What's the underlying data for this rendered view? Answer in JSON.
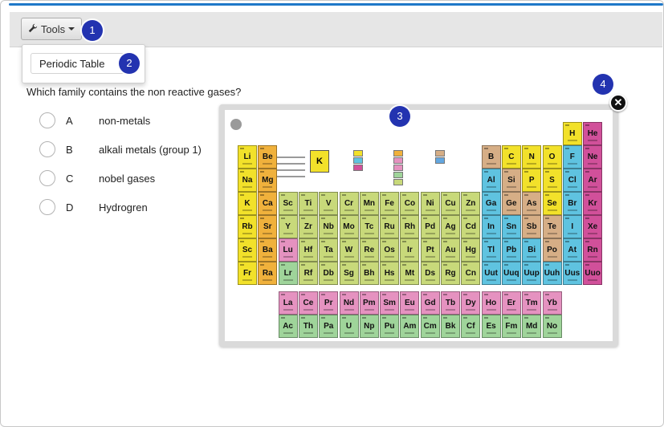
{
  "toolbar": {
    "tools_label": "Tools"
  },
  "dropdown": {
    "item": "Periodic Table"
  },
  "badges": [
    "1",
    "2",
    "3",
    "4"
  ],
  "question": {
    "text": "Which family contains the non reactive gases?"
  },
  "options": [
    {
      "letter": "A",
      "text": "non-metals"
    },
    {
      "letter": "B",
      "text": "alkali metals (group 1)"
    },
    {
      "letter": "C",
      "text": "nobel gases"
    },
    {
      "letter": "D",
      "text": "Hydrogren"
    }
  ],
  "popup": {
    "close_icon": "close-icon"
  },
  "colors": {
    "accent": "#1f78c8",
    "badge": "#2333b0",
    "yellow": "#f2e12a",
    "orange": "#f0b13c",
    "lime": "#c8d97a",
    "pink": "#e592c0",
    "cyan": "#5fc3e0",
    "tan": "#d6ae86",
    "magenta": "#d1509a",
    "green": "#9fd49a",
    "blue": "#63a7e0"
  },
  "periodic_table": {
    "rows": [
      {
        "cells": [
          [
            "H",
            "yellow"
          ],
          [
            "He",
            "magenta"
          ]
        ]
      },
      {
        "cells": [
          [
            "Li",
            "yellow"
          ],
          [
            "Be",
            "orange"
          ],
          [
            "B",
            "tan"
          ],
          [
            "C",
            "yellow"
          ],
          [
            "N",
            "yellow"
          ],
          [
            "O",
            "yellow"
          ],
          [
            "F",
            "cyan"
          ],
          [
            "Ne",
            "magenta"
          ]
        ]
      },
      {
        "cells": [
          [
            "Na",
            "yellow"
          ],
          [
            "Mg",
            "orange"
          ],
          [
            "Al",
            "cyan"
          ],
          [
            "Si",
            "tan"
          ],
          [
            "P",
            "yellow"
          ],
          [
            "S",
            "yellow"
          ],
          [
            "Cl",
            "cyan"
          ],
          [
            "Ar",
            "magenta"
          ]
        ]
      },
      {
        "cells": [
          [
            "K",
            "yellow"
          ],
          [
            "Ca",
            "orange"
          ],
          [
            "Sc",
            "lime"
          ],
          [
            "Ti",
            "lime"
          ],
          [
            "V",
            "lime"
          ],
          [
            "Cr",
            "lime"
          ],
          [
            "Mn",
            "lime"
          ],
          [
            "Fe",
            "lime"
          ],
          [
            "Co",
            "lime"
          ],
          [
            "Ni",
            "lime"
          ],
          [
            "Cu",
            "lime"
          ],
          [
            "Zn",
            "lime"
          ],
          [
            "Ga",
            "cyan"
          ],
          [
            "Ge",
            "tan"
          ],
          [
            "As",
            "tan"
          ],
          [
            "Se",
            "yellow"
          ],
          [
            "Br",
            "cyan"
          ],
          [
            "Kr",
            "magenta"
          ]
        ]
      },
      {
        "cells": [
          [
            "Rb",
            "yellow"
          ],
          [
            "Sr",
            "orange"
          ],
          [
            "Y",
            "lime"
          ],
          [
            "Zr",
            "lime"
          ],
          [
            "Nb",
            "lime"
          ],
          [
            "Mo",
            "lime"
          ],
          [
            "Tc",
            "lime"
          ],
          [
            "Ru",
            "lime"
          ],
          [
            "Rh",
            "lime"
          ],
          [
            "Pd",
            "lime"
          ],
          [
            "Ag",
            "lime"
          ],
          [
            "Cd",
            "lime"
          ],
          [
            "In",
            "cyan"
          ],
          [
            "Sn",
            "cyan"
          ],
          [
            "Sb",
            "tan"
          ],
          [
            "Te",
            "tan"
          ],
          [
            "I",
            "cyan"
          ],
          [
            "Xe",
            "magenta"
          ]
        ]
      },
      {
        "cells": [
          [
            "Sc",
            "yellow"
          ],
          [
            "Ba",
            "orange"
          ],
          [
            "Lu",
            "pink"
          ],
          [
            "Hf",
            "lime"
          ],
          [
            "Ta",
            "lime"
          ],
          [
            "W",
            "lime"
          ],
          [
            "Re",
            "lime"
          ],
          [
            "Os",
            "lime"
          ],
          [
            "Ir",
            "lime"
          ],
          [
            "Pt",
            "lime"
          ],
          [
            "Au",
            "lime"
          ],
          [
            "Hg",
            "lime"
          ],
          [
            "Tl",
            "cyan"
          ],
          [
            "Pb",
            "cyan"
          ],
          [
            "Bi",
            "cyan"
          ],
          [
            "Po",
            "tan"
          ],
          [
            "At",
            "cyan"
          ],
          [
            "Rn",
            "magenta"
          ]
        ]
      },
      {
        "cells": [
          [
            "Fr",
            "yellow"
          ],
          [
            "Ra",
            "orange"
          ],
          [
            "Lr",
            "green"
          ],
          [
            "Rf",
            "lime"
          ],
          [
            "Db",
            "lime"
          ],
          [
            "Sg",
            "lime"
          ],
          [
            "Bh",
            "lime"
          ],
          [
            "Hs",
            "lime"
          ],
          [
            "Mt",
            "lime"
          ],
          [
            "Ds",
            "lime"
          ],
          [
            "Rg",
            "lime"
          ],
          [
            "Cn",
            "lime"
          ],
          [
            "Uut",
            "cyan"
          ],
          [
            "Uuq",
            "cyan"
          ],
          [
            "Uup",
            "cyan"
          ],
          [
            "Uuh",
            "cyan"
          ],
          [
            "Uus",
            "cyan"
          ],
          [
            "Uuo",
            "magenta"
          ]
        ]
      },
      {
        "cells": [
          [
            "La",
            "pink"
          ],
          [
            "Ce",
            "pink"
          ],
          [
            "Pr",
            "pink"
          ],
          [
            "Nd",
            "pink"
          ],
          [
            "Pm",
            "pink"
          ],
          [
            "Sm",
            "pink"
          ],
          [
            "Eu",
            "pink"
          ],
          [
            "Gd",
            "pink"
          ],
          [
            "Tb",
            "pink"
          ],
          [
            "Dy",
            "pink"
          ],
          [
            "Ho",
            "pink"
          ],
          [
            "Er",
            "pink"
          ],
          [
            "Tm",
            "pink"
          ],
          [
            "Yb",
            "pink"
          ]
        ]
      },
      {
        "cells": [
          [
            "Ac",
            "green"
          ],
          [
            "Th",
            "green"
          ],
          [
            "Pa",
            "green"
          ],
          [
            "U",
            "green"
          ],
          [
            "Np",
            "green"
          ],
          [
            "Pu",
            "green"
          ],
          [
            "Am",
            "green"
          ],
          [
            "Cm",
            "green"
          ],
          [
            "Bk",
            "green"
          ],
          [
            "Cf",
            "green"
          ],
          [
            "Es",
            "green"
          ],
          [
            "Fm",
            "green"
          ],
          [
            "Md",
            "green"
          ],
          [
            "No",
            "green"
          ]
        ]
      }
    ],
    "legend_symbol": "K"
  }
}
